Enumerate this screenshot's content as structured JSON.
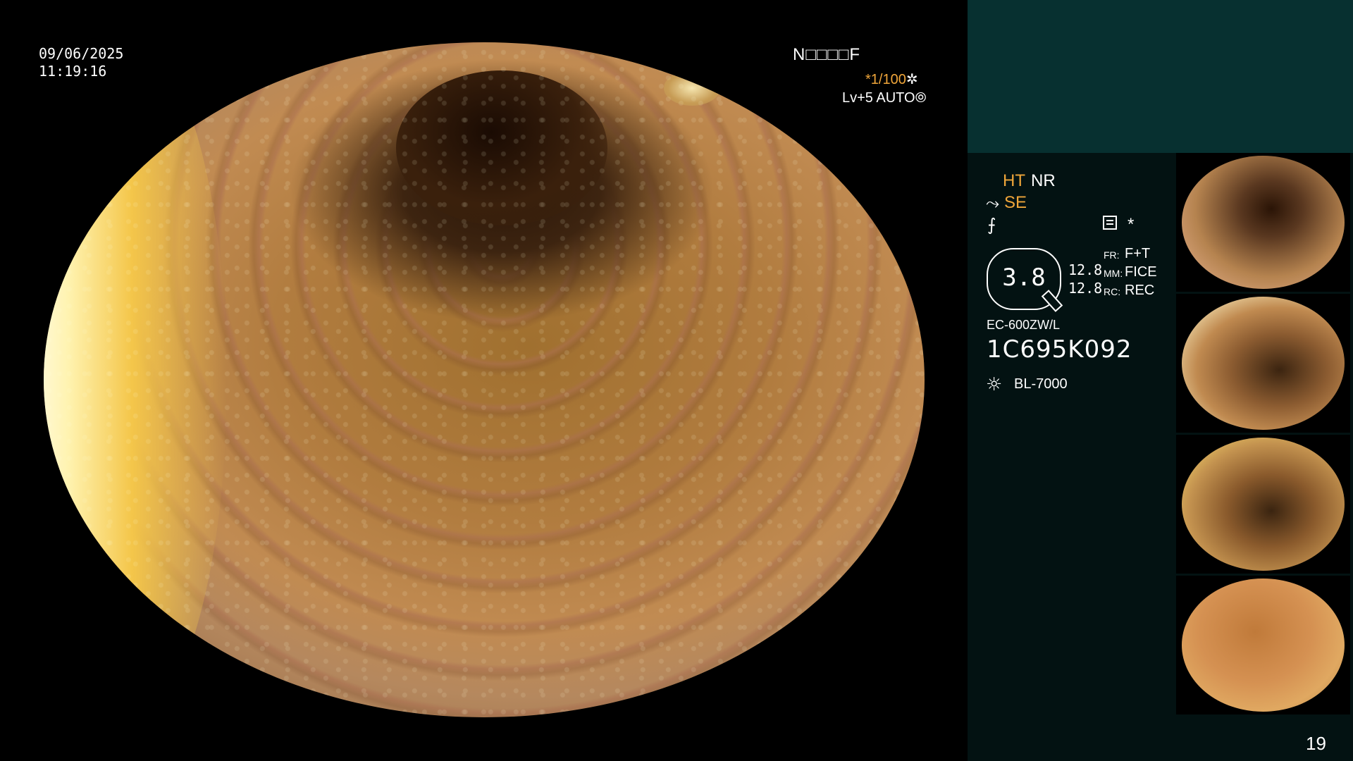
{
  "overlay": {
    "date": "09/06/2025",
    "time": "11:19:16",
    "patient_id": "N□□□□F",
    "shutter": "*1/100",
    "shutter_icon": "✲",
    "level": "Lv+5",
    "mode": "AUTO",
    "mode_icon": "⦾"
  },
  "panel": {
    "ht": "HT",
    "nr": "NR",
    "se_icon": "⤳",
    "se": "SE",
    "misc_icon": "⨍",
    "star": "*",
    "zoom": "3.8",
    "meta": [
      {
        "num": "12.8",
        "label": "FR:",
        "value": "F+T"
      },
      {
        "num": "12.8",
        "label": "MM:",
        "value": "FICE"
      },
      {
        "num": "12.8",
        "label": "RC:",
        "value": "REC"
      }
    ],
    "scope_model": "EC-600ZW/L",
    "scope_serial": "1C695K092",
    "light_icon": "☼",
    "light_source": "BL-7000"
  },
  "page_number": "19"
}
